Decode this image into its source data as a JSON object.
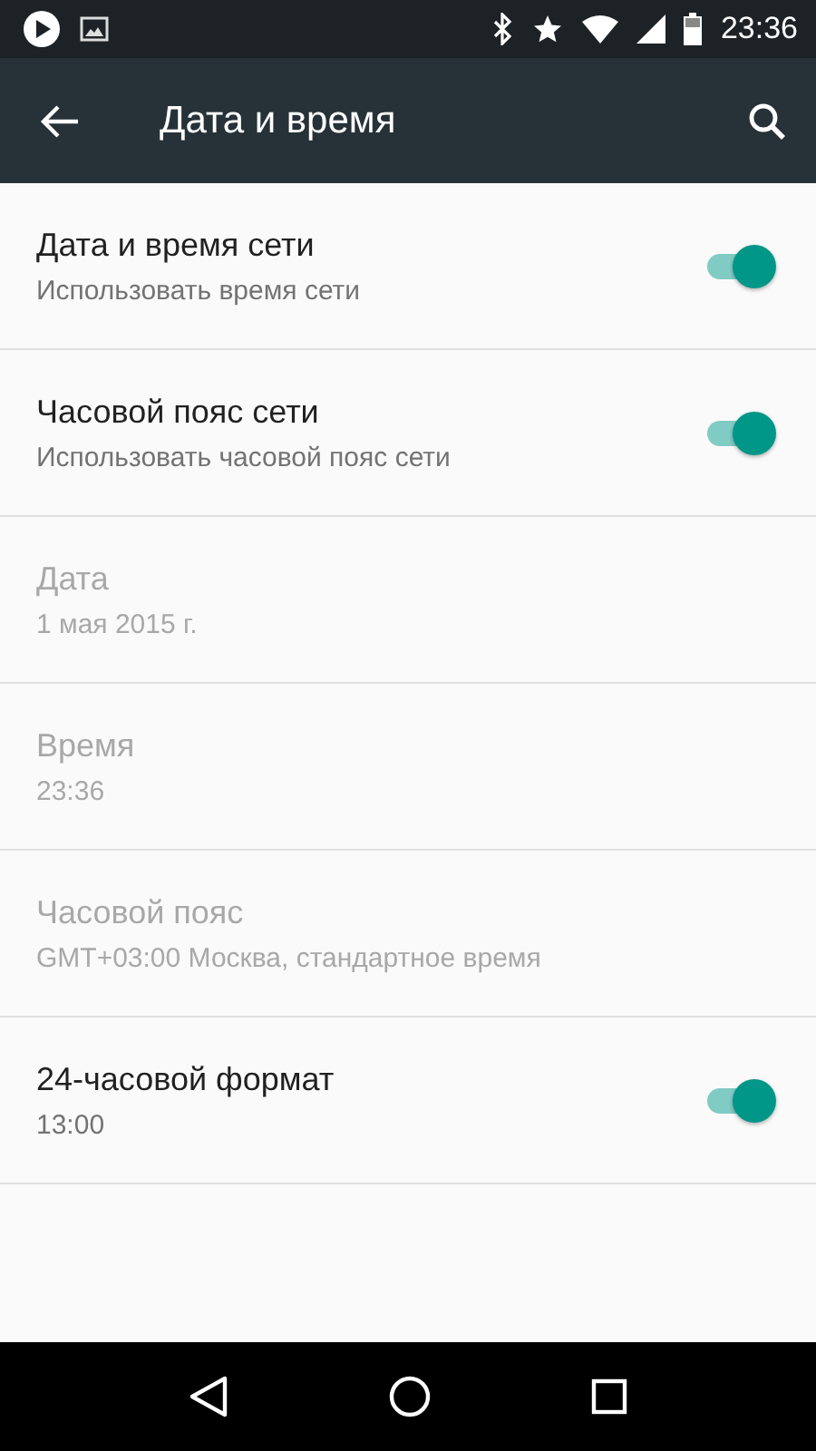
{
  "status_bar": {
    "time": "23:36"
  },
  "toolbar": {
    "title": "Дата и время"
  },
  "settings": [
    {
      "kind": "switch",
      "title": "Дата и время сети",
      "summary": "Использовать время сети",
      "disabled": false,
      "on": true
    },
    {
      "kind": "switch",
      "title": "Часовой пояс сети",
      "summary": "Использовать часовой пояс сети",
      "disabled": false,
      "on": true
    },
    {
      "kind": "text",
      "title": "Дата",
      "summary": "1 мая 2015 г.",
      "disabled": true
    },
    {
      "kind": "text",
      "title": "Время",
      "summary": "23:36",
      "disabled": true
    },
    {
      "kind": "text",
      "title": "Часовой пояс",
      "summary": "GMT+03:00 Москва, стандартное время",
      "disabled": true
    },
    {
      "kind": "switch",
      "title": "24-часовой формат",
      "summary": "13:00",
      "disabled": false,
      "on": true
    }
  ]
}
